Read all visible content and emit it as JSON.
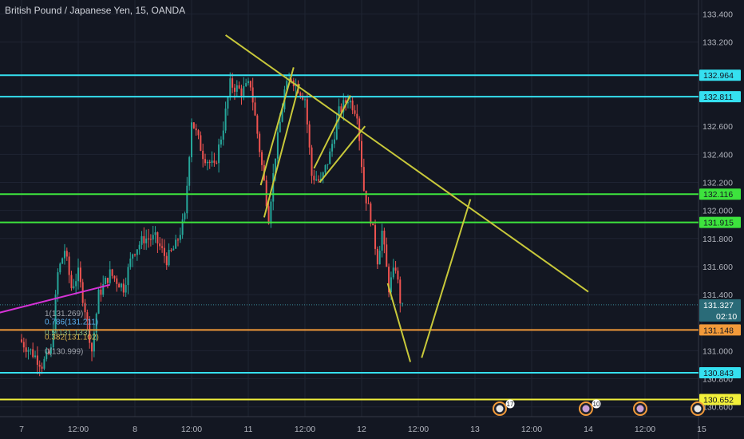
{
  "header": {
    "title": "British Pound / Japanese Yen, 15, OANDA"
  },
  "colors": {
    "background": "#131722",
    "grid": "#1f2433",
    "up_candle": "#26a69a",
    "down_candle": "#ef5350",
    "cyan_level": "#35e0f0",
    "green_level": "#3de33d",
    "orange_level": "#f29a3a",
    "yellow_level": "#f2f03a",
    "trend_yellow": "#c8c83a",
    "trend_magenta": "#d632d6",
    "axis_text": "#b2b5be",
    "last_price": "#3a8c9a"
  },
  "chart_data": {
    "type": "candlestick",
    "ylim": [
      130.53,
      133.5
    ],
    "y_ticks": [
      "133.400",
      "133.200",
      "132.964",
      "132.811",
      "132.600",
      "132.400",
      "132.200",
      "132.116",
      "132.000",
      "131.915",
      "131.800",
      "131.600",
      "131.400",
      "131.327",
      "131.148",
      "131.000",
      "130.843",
      "130.800",
      "130.652",
      "130.600"
    ],
    "x_ticks": [
      "7",
      "12:00",
      "8",
      "12:00",
      "11",
      "12:00",
      "12",
      "12:00",
      "13",
      "12:00",
      "14",
      "12:00",
      "15"
    ],
    "horizontal_levels": [
      {
        "price": 132.964,
        "label": "132.964",
        "color": "cyan"
      },
      {
        "price": 132.811,
        "label": "132.811",
        "color": "cyan"
      },
      {
        "price": 132.116,
        "label": "132.116",
        "color": "green"
      },
      {
        "price": 131.915,
        "label": "131.915",
        "color": "green"
      },
      {
        "price": 131.148,
        "label": "131.148",
        "color": "orange"
      },
      {
        "price": 130.843,
        "label": "130.843",
        "color": "cyan"
      },
      {
        "price": 130.652,
        "label": "130.652",
        "color": "yellow"
      }
    ],
    "last_price": {
      "price": 131.327,
      "label": "131.327",
      "countdown": "02:10"
    },
    "fibonacci": [
      {
        "label": "1(131.269)",
        "price": 131.269
      },
      {
        "label": "0.786(131.211)",
        "price": 131.211
      },
      {
        "label": "0.5(131.133)",
        "price": 131.133
      },
      {
        "label": "0.382(131.102)",
        "price": 131.102
      },
      {
        "label": "0(130.999)",
        "price": 130.999
      }
    ],
    "event_badges": [
      {
        "day": "13",
        "count": "17"
      },
      {
        "day": "14",
        "count": "10"
      },
      {
        "day": "14.5",
        "count": ""
      },
      {
        "day": "15",
        "count": ""
      }
    ],
    "ohlc_anchors": [
      {
        "t": 0.0,
        "p": 131.08
      },
      {
        "t": 0.12,
        "p": 130.98
      },
      {
        "t": 0.2,
        "p": 130.9
      },
      {
        "t": 0.28,
        "p": 131.0
      },
      {
        "t": 0.34,
        "p": 131.55
      },
      {
        "t": 0.4,
        "p": 131.72
      },
      {
        "t": 0.46,
        "p": 131.45
      },
      {
        "t": 0.52,
        "p": 131.55
      },
      {
        "t": 0.58,
        "p": 131.3
      },
      {
        "t": 0.64,
        "p": 131.0
      },
      {
        "t": 0.7,
        "p": 131.4
      },
      {
        "t": 0.8,
        "p": 131.55
      },
      {
        "t": 0.92,
        "p": 131.45
      },
      {
        "t": 1.0,
        "p": 131.7
      },
      {
        "t": 1.1,
        "p": 131.8
      },
      {
        "t": 1.2,
        "p": 131.8
      },
      {
        "t": 1.3,
        "p": 131.65
      },
      {
        "t": 1.38,
        "p": 131.75
      },
      {
        "t": 1.46,
        "p": 131.95
      },
      {
        "t": 1.52,
        "p": 132.65
      },
      {
        "t": 1.62,
        "p": 132.4
      },
      {
        "t": 1.72,
        "p": 132.3
      },
      {
        "t": 1.8,
        "p": 132.6
      },
      {
        "t": 1.86,
        "p": 132.9
      },
      {
        "t": 1.96,
        "p": 132.85
      },
      {
        "t": 2.04,
        "p": 132.9
      },
      {
        "t": 2.1,
        "p": 132.55
      },
      {
        "t": 2.16,
        "p": 132.2
      },
      {
        "t": 2.2,
        "p": 131.95
      },
      {
        "t": 2.26,
        "p": 132.4
      },
      {
        "t": 2.34,
        "p": 132.85
      },
      {
        "t": 2.4,
        "p": 132.95
      },
      {
        "t": 2.48,
        "p": 132.85
      },
      {
        "t": 2.52,
        "p": 132.8
      },
      {
        "t": 2.58,
        "p": 132.25
      },
      {
        "t": 2.66,
        "p": 132.2
      },
      {
        "t": 2.74,
        "p": 132.4
      },
      {
        "t": 2.82,
        "p": 132.7
      },
      {
        "t": 2.9,
        "p": 132.8
      },
      {
        "t": 2.98,
        "p": 132.7
      },
      {
        "t": 3.04,
        "p": 132.15
      },
      {
        "t": 3.1,
        "p": 131.95
      },
      {
        "t": 3.16,
        "p": 131.65
      },
      {
        "t": 3.2,
        "p": 131.85
      },
      {
        "t": 3.26,
        "p": 131.45
      },
      {
        "t": 3.32,
        "p": 131.6
      },
      {
        "t": 3.37,
        "p": 131.3
      }
    ],
    "trend_lines": [
      {
        "color": "trend_yellow",
        "t1": 1.8,
        "p1": 133.25,
        "t2": 5.0,
        "p2": 131.42
      },
      {
        "color": "trend_yellow",
        "t1": 2.11,
        "p1": 132.18,
        "t2": 2.4,
        "p2": 133.02
      },
      {
        "color": "trend_yellow",
        "t1": 2.14,
        "p1": 131.95,
        "t2": 2.45,
        "p2": 132.9
      },
      {
        "color": "trend_yellow",
        "t1": 2.58,
        "p1": 132.3,
        "t2": 2.9,
        "p2": 132.82
      },
      {
        "color": "trend_yellow",
        "t1": 2.63,
        "p1": 132.2,
        "t2": 3.03,
        "p2": 132.6
      },
      {
        "color": "trend_yellow",
        "t1": 3.23,
        "p1": 131.48,
        "t2": 3.43,
        "p2": 130.92
      },
      {
        "color": "trend_yellow",
        "t1": 3.53,
        "p1": 130.95,
        "t2": 3.96,
        "p2": 132.08
      },
      {
        "color": "trend_magenta",
        "t1": -0.2,
        "p1": 131.27,
        "t2": 0.78,
        "p2": 131.47
      }
    ]
  }
}
